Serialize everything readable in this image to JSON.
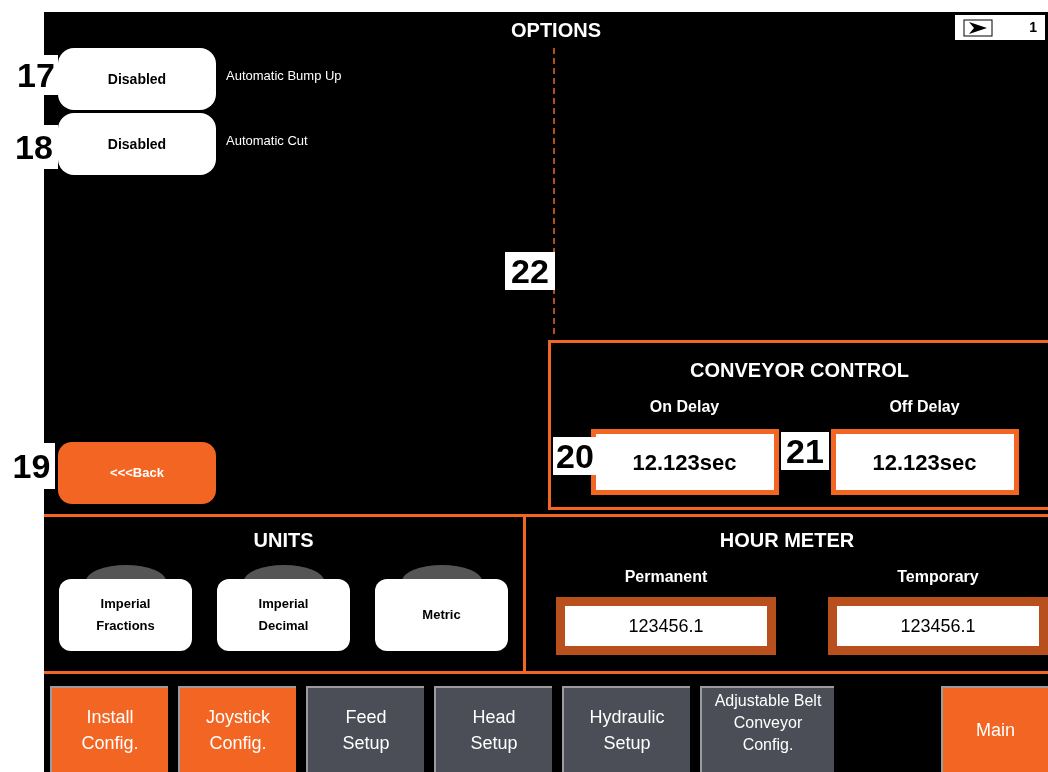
{
  "title": "OPTIONS",
  "page_indicator": {
    "number": "1"
  },
  "options": [
    {
      "value": "Disabled",
      "label": "Automatic Bump Up"
    },
    {
      "value": "Disabled",
      "label": "Automatic Cut"
    }
  ],
  "back_button": "<<<Back",
  "conveyor_control": {
    "title": "CONVEYOR CONTROL",
    "fields": [
      {
        "label": "On Delay",
        "value": "12.123sec"
      },
      {
        "label": "Off Delay",
        "value": "12.123sec"
      }
    ]
  },
  "units": {
    "title": "UNITS",
    "options": [
      {
        "line1": "Imperial",
        "line2": "Fractions"
      },
      {
        "line1": "Imperial",
        "line2": "Decimal"
      },
      {
        "line1": "Metric"
      }
    ]
  },
  "hour_meter": {
    "title": "HOUR METER",
    "fields": [
      {
        "label": "Permanent",
        "value": "123456.1"
      },
      {
        "label": "Temporary",
        "value": "123456.1"
      }
    ]
  },
  "nav": [
    {
      "label": "Install Config.",
      "color": "#f26522"
    },
    {
      "label": "Joystick Config.",
      "color": "#f26522"
    },
    {
      "label": "Feed Setup",
      "color": "#4b4e56"
    },
    {
      "label": "Head Setup",
      "color": "#4b4e56"
    },
    {
      "label": "Hydraulic Setup",
      "color": "#4b4e56"
    },
    {
      "label": "Adjustable Belt Conveyor Config.",
      "color": "#4b4e56"
    },
    {
      "label": "Main",
      "color": "#f26522"
    }
  ],
  "callouts": [
    "17",
    "18",
    "19",
    "20",
    "21",
    "22"
  ]
}
